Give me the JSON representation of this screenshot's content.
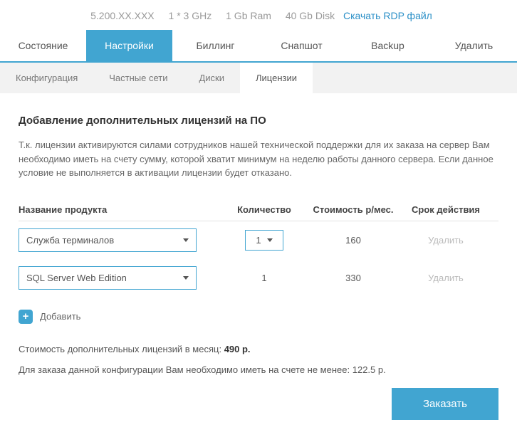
{
  "server_info": {
    "ip": "5.200.XX.XXX",
    "cpu": "1 * 3 GHz",
    "ram": "1 Gb Ram",
    "disk": "40 Gb Disk",
    "rdp_link": "Скачать RDP файл"
  },
  "main_tabs": [
    "Состояние",
    "Настройки",
    "Биллинг",
    "Снапшот",
    "Backup",
    "Удалить"
  ],
  "main_tab_active": 1,
  "sub_tabs": [
    "Конфигурация",
    "Частные сети",
    "Диски",
    "Лицензии"
  ],
  "sub_tab_active": 3,
  "heading": "Добавление дополнительных лицензий на ПО",
  "description": "Т.к. лицензии активируются силами сотрудников нашей технической поддержки для их заказа на сервер Вам необходимо иметь на счету сумму, которой хватит минимум на неделю работы данного сервера. Если данное условие не выполняется в активации лицензии будет отказано.",
  "table": {
    "headers": {
      "name": "Название продукта",
      "qty": "Количество",
      "cost": "Стоимость р/мес.",
      "term": "Срок действия"
    },
    "rows": [
      {
        "product": "Служба терминалов",
        "qty": "1",
        "qty_editable": true,
        "cost": "160",
        "action": "Удалить"
      },
      {
        "product": "SQL Server Web Edition",
        "qty": "1",
        "qty_editable": false,
        "cost": "330",
        "action": "Удалить"
      }
    ]
  },
  "add_label": "Добавить",
  "summary_cost_label": "Стоимость дополнительных лицензий в месяц:",
  "summary_cost_value": "490 р.",
  "summary_min_label": "Для заказа данной конфигурации Вам необходимо иметь на счете не менее:",
  "summary_min_value": "122.5 р.",
  "order_button": "Заказать"
}
